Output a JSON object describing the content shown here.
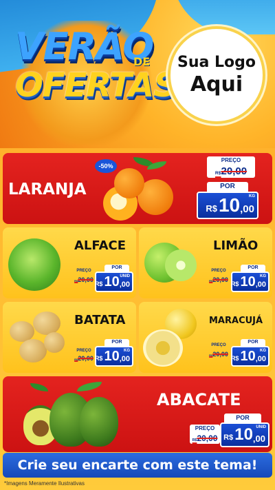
{
  "header": {
    "title_line1": "VERÃO",
    "title_de": "DE",
    "title_line2": "OFERTAS",
    "logo_line1": "Sua Logo",
    "logo_line2": "Aqui"
  },
  "labels": {
    "preco": "PREÇO",
    "por": "POR",
    "rs": "R$"
  },
  "featured": {
    "name": "LARANJA",
    "badge": "-50%",
    "old_price": "20,00",
    "new_int": "10",
    "new_dec": ",00",
    "unit": "KG"
  },
  "items": [
    {
      "name": "ALFACE",
      "old_price": "20,00",
      "new_int": "10",
      "new_dec": ",00",
      "unit": "UNID"
    },
    {
      "name": "LIMÃO",
      "old_price": "20,00",
      "new_int": "10",
      "new_dec": ",00",
      "unit": "KG"
    },
    {
      "name": "BATATA",
      "old_price": "20,00",
      "new_int": "10",
      "new_dec": ",00",
      "unit": "KG"
    },
    {
      "name": "MARACUJÁ",
      "old_price": "20,00",
      "new_int": "10",
      "new_dec": ",00",
      "unit": "KG"
    }
  ],
  "bottom": {
    "name": "ABACATE",
    "old_price": "20,00",
    "new_int": "10",
    "new_dec": ",00",
    "unit": "UNID"
  },
  "cta": "Crie seu encarte com este tema!",
  "disclaimer": "*Imagens Meramente Ilustrativas"
}
